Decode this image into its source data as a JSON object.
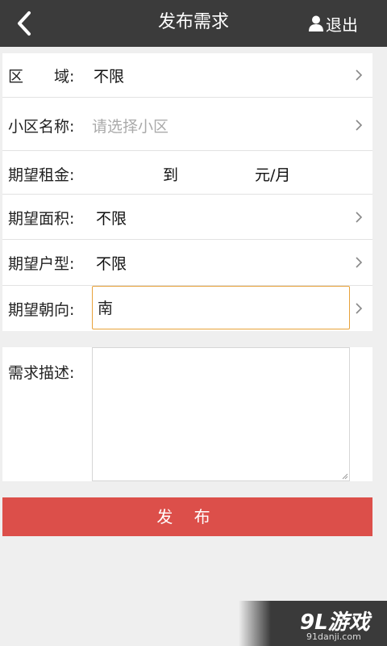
{
  "header": {
    "title": "发布需求",
    "logout_label": "退出"
  },
  "form": {
    "area": {
      "label": "区　　域:",
      "value": "不限"
    },
    "community": {
      "label": "小区名称:",
      "placeholder": "请选择小区"
    },
    "rent": {
      "label": "期望租金:",
      "to": "到",
      "unit": "元/月"
    },
    "size": {
      "label": "期望面积:",
      "value": "不限"
    },
    "layout": {
      "label": "期望户型:",
      "value": "不限"
    },
    "orientation": {
      "label": "期望朝向:",
      "value": "南"
    },
    "description": {
      "label": "需求描述:",
      "value": ""
    }
  },
  "actions": {
    "publish_label": "发 布"
  },
  "watermark": {
    "brand": "9L游戏",
    "url": "91danji.com"
  },
  "colors": {
    "header_bg": "#3b3b3b",
    "publish_bg": "#dc4f4a",
    "focus_border": "#e8a23a",
    "page_bg": "#efefef"
  }
}
